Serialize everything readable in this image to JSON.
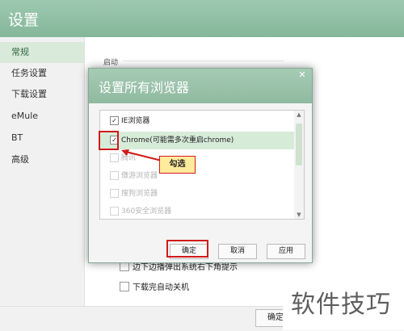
{
  "window": {
    "title": "设置",
    "sidebar": {
      "items": [
        {
          "label": "常规",
          "active": true
        },
        {
          "label": "任务设置",
          "active": false
        },
        {
          "label": "下载设置",
          "active": false
        },
        {
          "label": "eMule",
          "active": false
        },
        {
          "label": "BT",
          "active": false
        },
        {
          "label": "高级",
          "active": false
        }
      ]
    },
    "main": {
      "section_start": "启动",
      "options": [
        {
          "label": "边下边播弹出系统右下角提示",
          "checked": false
        },
        {
          "label": "下载完自动关机",
          "checked": false
        }
      ]
    },
    "ok_label": "确定"
  },
  "dialog": {
    "title": "设置所有浏览器",
    "browsers": [
      {
        "label": "IE浏览器",
        "checked": true,
        "enabled": true
      },
      {
        "label": "Chrome(可能需多次重启chrome)",
        "checked": true,
        "enabled": true,
        "highlighted": true
      },
      {
        "label": "腾讯",
        "checked": false,
        "enabled": false
      },
      {
        "label": "傲游浏览器",
        "checked": false,
        "enabled": false
      },
      {
        "label": "搜狗浏览器",
        "checked": false,
        "enabled": false
      },
      {
        "label": "360安全浏览器",
        "checked": false,
        "enabled": false
      }
    ],
    "buttons": {
      "ok": "确定",
      "cancel": "取消",
      "apply": "应用"
    }
  },
  "annotation": {
    "callout": "勾选",
    "color": "#d11a1a"
  },
  "watermark": "软件技巧",
  "colors": {
    "header_green": "#8fbaa0",
    "highlight_green": "#d7ebd9",
    "accent_red": "#d11a1a"
  }
}
